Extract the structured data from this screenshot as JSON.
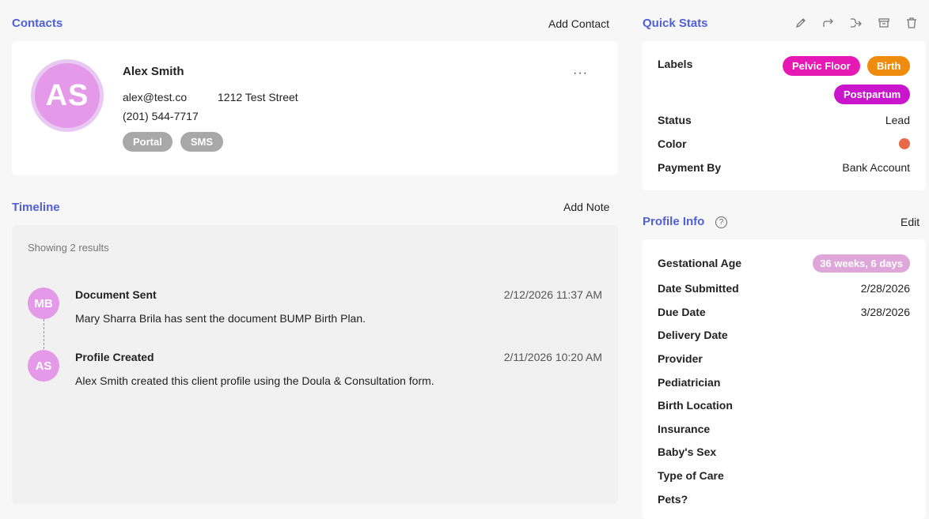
{
  "contacts": {
    "title": "Contacts",
    "add_label": "Add Contact",
    "avatar_initials": "AS",
    "name": "Alex Smith",
    "email": "alex@test.co",
    "address": "1212 Test Street",
    "phone": "(201) 544-7717",
    "tags": [
      "Portal",
      "SMS"
    ],
    "more_label": "···"
  },
  "timeline": {
    "title": "Timeline",
    "add_label": "Add Note",
    "showing": "Showing 2 results",
    "events": [
      {
        "initials": "MB",
        "title": "Document Sent",
        "date": "2/12/2026 11:37 AM",
        "desc": "Mary Sharra Brila has sent the document BUMP Birth Plan."
      },
      {
        "initials": "AS",
        "title": "Profile Created",
        "date": "2/11/2026 10:20 AM",
        "desc": "Alex Smith created this client profile using the Doula & Consultation form."
      }
    ]
  },
  "quick_stats": {
    "title": "Quick Stats",
    "icons": [
      "pencil-icon",
      "forward-icon",
      "exit-icon",
      "archive-icon",
      "trash-icon"
    ],
    "labels_label": "Labels",
    "labels": [
      {
        "text": "Pelvic Floor",
        "color": "#e619b5"
      },
      {
        "text": "Birth",
        "color": "#ef8c0e"
      },
      {
        "text": "Postpartum",
        "color": "#c916cc"
      }
    ],
    "status_label": "Status",
    "status_value": "Lead",
    "color_label": "Color",
    "color_value": "#e8694a",
    "payment_label": "Payment By",
    "payment_value": "Bank Account"
  },
  "profile_info": {
    "title": "Profile Info",
    "help_glyph": "?",
    "edit_label": "Edit",
    "rows": [
      {
        "label": "Gestational Age",
        "value": "36 weeks, 6 days"
      },
      {
        "label": "Date Submitted",
        "value": "2/28/2026"
      },
      {
        "label": "Due Date",
        "value": "3/28/2026"
      },
      {
        "label": "Delivery Date",
        "value": ""
      },
      {
        "label": "Provider",
        "value": ""
      },
      {
        "label": "Pediatrician",
        "value": ""
      },
      {
        "label": "Birth Location",
        "value": ""
      },
      {
        "label": "Insurance",
        "value": ""
      },
      {
        "label": "Baby's Sex",
        "value": ""
      },
      {
        "label": "Type of Care",
        "value": ""
      },
      {
        "label": "Pets?",
        "value": ""
      }
    ]
  }
}
